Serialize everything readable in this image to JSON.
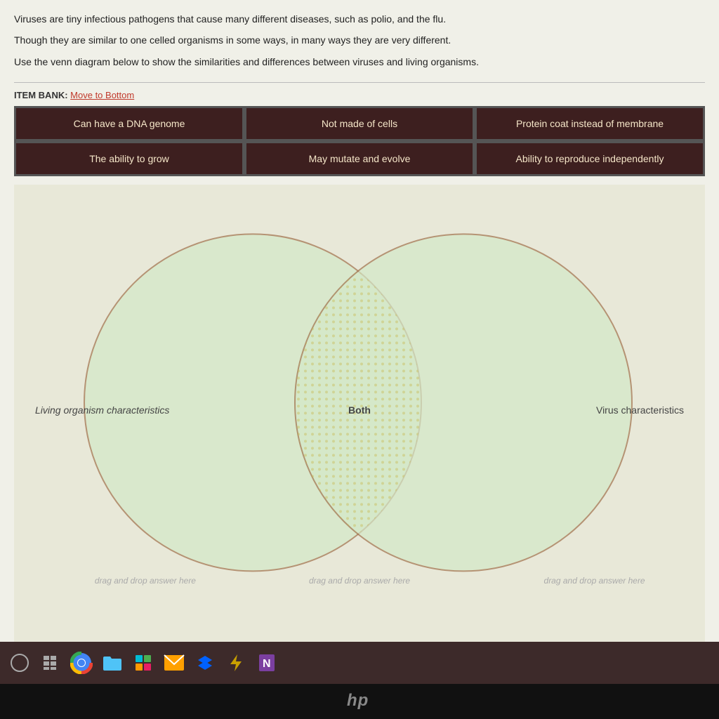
{
  "intro": {
    "line1": "Viruses are tiny infectious pathogens that cause many different diseases, such as polio, and the flu.",
    "line2": "Though they are similar to one celled organisms in some ways, in many ways they are very different.",
    "line3": "Use the venn diagram below to show the similarities and differences between viruses and living organisms."
  },
  "item_bank": {
    "label": "ITEM BANK:",
    "link_text": "Move to Bottom",
    "items": [
      {
        "id": "item1",
        "text": "Can have a DNA genome"
      },
      {
        "id": "item2",
        "text": "Not made of cells"
      },
      {
        "id": "item3",
        "text": "Protein coat instead of membrane"
      },
      {
        "id": "item4",
        "text": "The ability to grow"
      },
      {
        "id": "item5",
        "text": "May mutate and evolve"
      },
      {
        "id": "item6",
        "text": "Ability to reproduce independently"
      }
    ]
  },
  "venn": {
    "left_label": "Living organism characteristics",
    "center_label": "Both",
    "right_label": "Virus characteristics",
    "drop_placeholder": "drag and drop answer here"
  },
  "taskbar": {
    "icons": [
      "circle",
      "grid",
      "chrome",
      "folder",
      "apps",
      "mail",
      "dropbox",
      "bolt",
      "clip"
    ]
  },
  "hp": {
    "logo": "hp"
  }
}
